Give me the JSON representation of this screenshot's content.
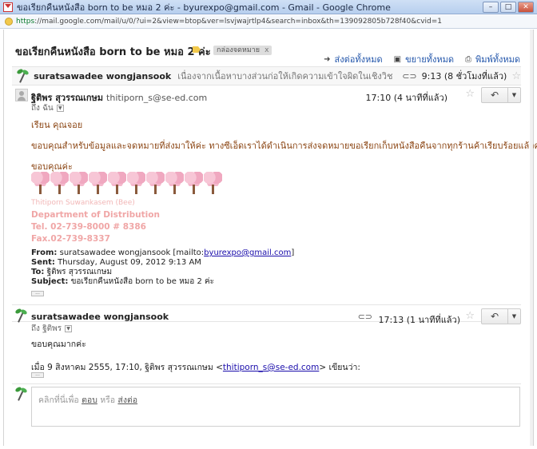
{
  "window": {
    "title": "ขอเรียกคืนหนังสือ born to be หมอ 2 ค่ะ - byurexpo@gmail.com - Gmail - Google Chrome",
    "minimize": "–",
    "maximize": "□",
    "close": "✕"
  },
  "address": {
    "https": "https",
    "url": "://mail.google.com/mail/u/0/?ui=2&view=btop&ver=lsvjwajrtlp4&search=inbox&th=139092805b728f40&cvid=1"
  },
  "thread": {
    "subject": "ขอเรียกคืนหนังสือ born to be หมอ 2 ค่ะ",
    "label": "กล่องจดหมาย",
    "label_remove": "x",
    "actions": {
      "forward_all": "ส่งต่อทั้งหมด",
      "expand_all": "ขยายทั้งหมด",
      "print_all": "พิมพ์ทั้งหมด"
    }
  },
  "collapsed_message": {
    "sender": "suratsawadee wongjansook",
    "snippet": "เนื่องจากเนื้อหาบางส่วนก่อให้เกิดความเข้าใจผิดในเชิงวิชาชีพทางการเรียนมาทำ...",
    "time": "9:13 (8 ชั่วโมงที่แล้ว)"
  },
  "message1": {
    "sender_name": "ฐิติพร สุวรรณเกษม",
    "sender_email": "thitiporn_s@se-ed.com",
    "to": "ถึง ฉัน",
    "time": "17:10 (4 นาทีที่แล้ว)",
    "body": [
      "เรียน     คุณจอย",
      "ขอบคุณสำหรับข้อมูลและจดหมายที่ส่งมาให้ค่ะ  ทางซีเอ็ดเราได้ดำเนินการส่งจดหมายขอเรียกเก็บหนังสือคืนจากทุกร้านค้าเรียบร้อยแล้วค่ะ",
      "ขอบคุณค่ะ"
    ],
    "signature": {
      "name": "Thitiporn Suwankasem (Bee)",
      "dept": "Department of Distribution",
      "tel": "Tel. 02-739-8000 # 8386",
      "fax": "Fax.02-739-8337"
    },
    "quoted": {
      "from_label": "From:",
      "from_value": "suratsawadee wongjansook [mailto:",
      "from_link": "byurexpo@gmail.com",
      "from_end": "]",
      "sent_label": "Sent:",
      "sent_value": "Thursday, August 09, 2012 9:13 AM",
      "to_label": "To:",
      "to_value": "ฐิติพร สุวรรณเกษม",
      "subject_label": "Subject:",
      "subject_value": "ขอเรียกคืนหนังสือ born to be หมอ 2 ค่ะ"
    },
    "ellipsis": "..."
  },
  "message2": {
    "sender_name": "suratsawadee wongjansook",
    "to": "ถึง ฐิติพร",
    "time": "17:13 (1 นาทีที่แล้ว)",
    "body_line": "ขอบคุณมากค่ะ",
    "quote_prefix": "เมื่อ 9 สิงหาคม 2555, 17:10, ฐิติพร สุวรรณเกษม   <",
    "quote_link": "thitiporn_s@se-ed.com",
    "quote_suffix": "> เขียนว่า:",
    "ellipsis": "..."
  },
  "reply_box": {
    "prefix": "คลิกที่นี่เพื่อ ",
    "reply": "ตอบ",
    "or": " หรือ ",
    "forward": "ส่งต่อ"
  }
}
